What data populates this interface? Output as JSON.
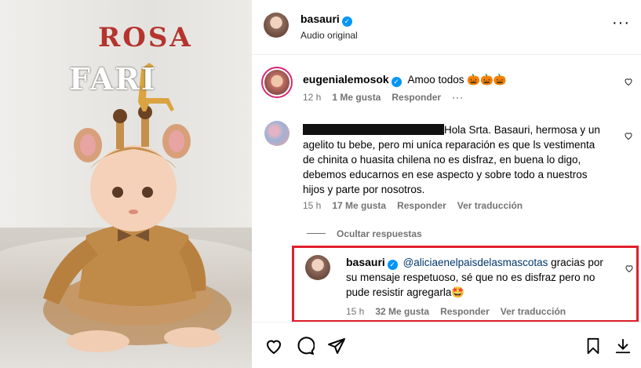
{
  "media": {
    "overlay_line1": "ROSA",
    "overlay_line2": "FARI"
  },
  "header": {
    "username": "basauri",
    "subtitle": "Audio original",
    "more_icon": "more-horizontal-icon"
  },
  "comments": [
    {
      "username": "eugenialemosok",
      "text": "Amoo todos 🎃🎃🎃",
      "time": "12 h",
      "likes": "1 Me gusta",
      "reply": "Responder",
      "options_icon": "more-horizontal-icon"
    },
    {
      "username_redacted": true,
      "text_lines": [
        "Hola Srta. Basauri, hermosa y un",
        "agelito tu bebe, pero mi uníca reparación es que ls vestimenta",
        "de chinita o huasita chilena no es disfraz, en buena lo digo,",
        "debemos educarnos en ese aspecto y sobre todo a nuestros",
        "hijos y parte por nosotros."
      ],
      "time": "15 h",
      "likes": "17 Me gusta",
      "reply": "Responder",
      "translate": "Ver traducción"
    }
  ],
  "hide_replies": "Ocultar respuestas",
  "reply": {
    "username": "basauri",
    "mention": "@aliciaenelpaisdelasmascotas",
    "text_lines": [
      " gracias por",
      "su mensaje respetuoso, sé que no es disfraz pero no",
      "pude resistir agregarla🤩"
    ],
    "time": "15 h",
    "likes": "32 Me gusta",
    "reply": "Responder",
    "translate": "Ver traducción"
  },
  "colors": {
    "accent": "#0095f6",
    "highlight": "#e0202b",
    "meta": "#737373",
    "mention": "#00376b"
  }
}
